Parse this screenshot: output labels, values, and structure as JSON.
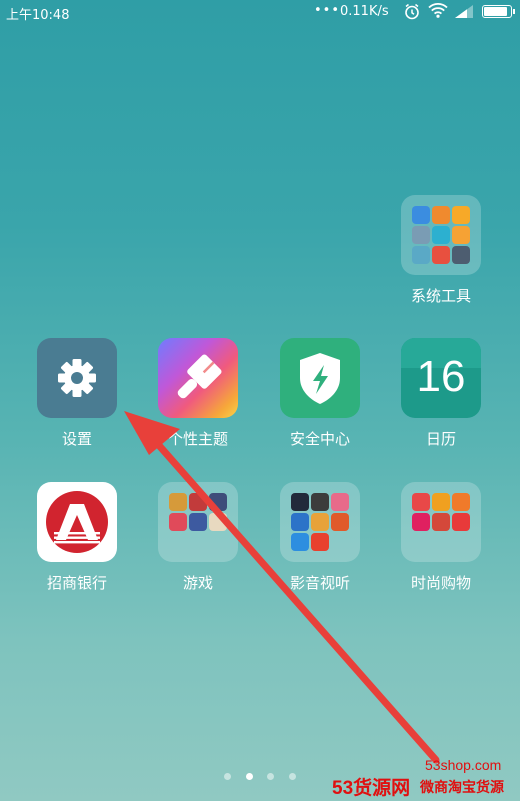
{
  "status_bar": {
    "time": "上午10:48",
    "dots": "•••",
    "speed": "0.11K/s",
    "battery_level": 0.9
  },
  "apps": {
    "system_tools": {
      "label": "系统工具"
    },
    "settings": {
      "label": "设置"
    },
    "themes": {
      "label": "个性主题"
    },
    "security": {
      "label": "安全中心"
    },
    "calendar": {
      "label": "日历",
      "day": "16"
    },
    "cmb_bank": {
      "label": "招商银行"
    },
    "games": {
      "label": "游戏"
    },
    "video": {
      "label": "影音视听"
    },
    "shopping": {
      "label": "时尚购物"
    }
  },
  "folder_icon_colors": {
    "system_tools": [
      "#3b8de0",
      "#f08a2e",
      "#f7a928",
      "#7a9cb4",
      "#2cb0d0",
      "#f6a234",
      "#5aa9c6",
      "#e8503f",
      "#4d5d70"
    ],
    "games": [
      "#d69a3a",
      "#c23b3b",
      "#3e4d7a",
      "#e04a5a",
      "#3d5aa0",
      "#e8d9c0"
    ],
    "video": [
      "#222a3a",
      "#3c3c3c",
      "#e86a8a",
      "#2c73c8",
      "#e8a23a",
      "#e05a2a",
      "#2d8ee0",
      "#e8402e"
    ],
    "shopping": [
      "#e84848",
      "#f0a020",
      "#f07a2a",
      "#e02060",
      "#d4483a",
      "#e83a3a"
    ]
  },
  "pager": {
    "pages": 4,
    "active": 2
  },
  "watermark": {
    "url": "53shop.com",
    "brand": "53货源网",
    "sub": "微商淘宝货源"
  },
  "colors": {
    "arrow": "#e8403a",
    "watermark": "#e01010"
  }
}
